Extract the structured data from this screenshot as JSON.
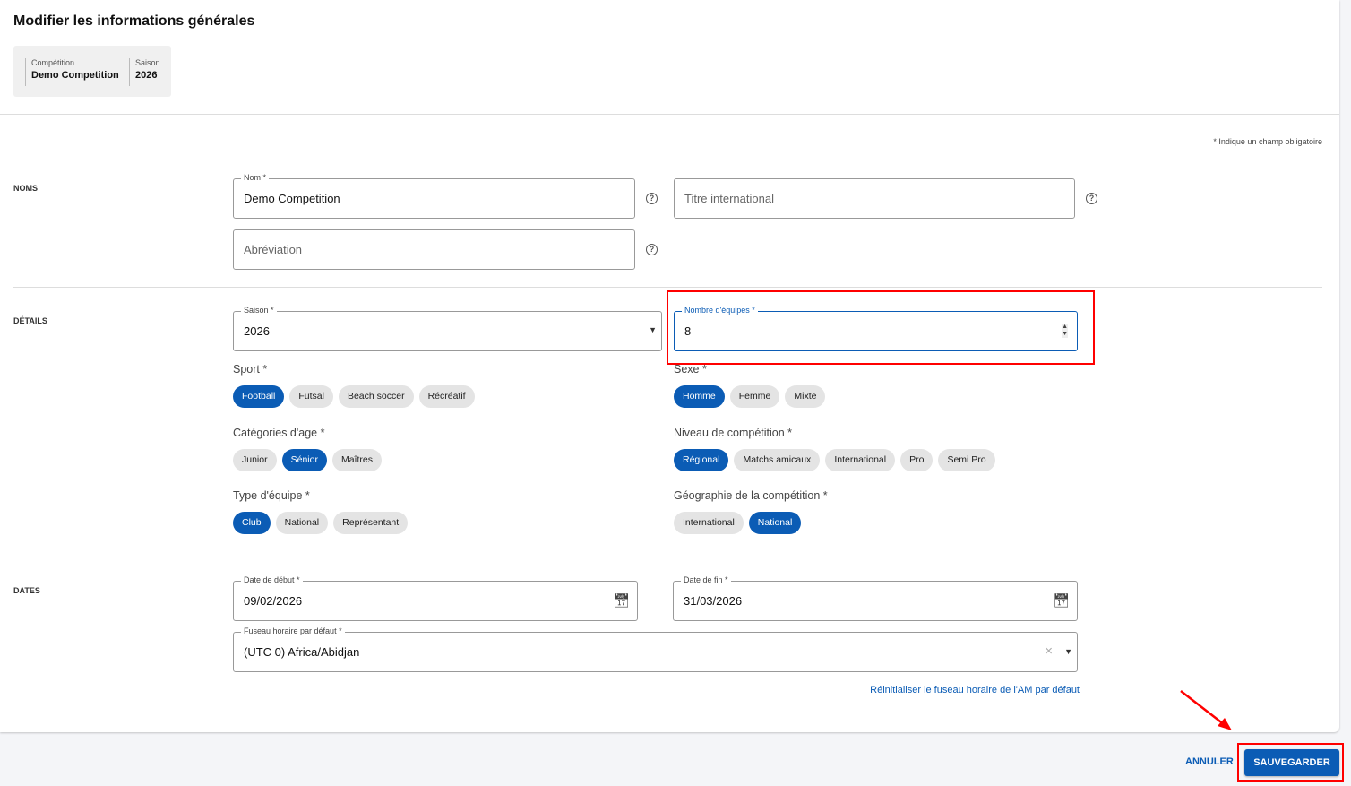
{
  "title": "Modifier les informations générales",
  "info": {
    "competition_label": "Compétition",
    "competition_value": "Demo Competition",
    "season_label": "Saison",
    "season_value": "2026"
  },
  "required_note": "* Indique un champ obligatoire",
  "sections": {
    "noms": "NOMS",
    "details": "DÉTAILS",
    "dates": "DATES"
  },
  "fields": {
    "nom": {
      "label": "Nom *",
      "value": "Demo Competition"
    },
    "titre": {
      "placeholder": "Titre international"
    },
    "abreviation": {
      "placeholder": "Abréviation"
    },
    "saison": {
      "label": "Saison *",
      "value": "2026"
    },
    "nombre": {
      "label": "Nombre d'équipes *",
      "value": "8"
    },
    "debut": {
      "label": "Date de début *",
      "value": "09/02/2026"
    },
    "fin": {
      "label": "Date de fin *",
      "value": "31/03/2026"
    },
    "fuseau": {
      "label": "Fuseau horaire par défaut *",
      "value": "(UTC 0) Africa/Abidjan"
    }
  },
  "groups": {
    "sport": {
      "label": "Sport *",
      "options": [
        "Football",
        "Futsal",
        "Beach soccer",
        "Récréatif"
      ],
      "selected": [
        "Football"
      ]
    },
    "sexe": {
      "label": "Sexe *",
      "options": [
        "Homme",
        "Femme",
        "Mixte"
      ],
      "selected": [
        "Homme"
      ]
    },
    "categories": {
      "label": "Catégories d'age *",
      "options": [
        "Junior",
        "Sénior",
        "Maîtres"
      ],
      "selected": [
        "Sénior"
      ]
    },
    "niveau": {
      "label": "Niveau de compétition *",
      "options": [
        "Régional",
        "Matchs amicaux",
        "International",
        "Pro",
        "Semi Pro"
      ],
      "selected": [
        "Régional"
      ]
    },
    "type": {
      "label": "Type d'équipe *",
      "options": [
        "Club",
        "National",
        "Représentant"
      ],
      "selected": [
        "Club"
      ]
    },
    "geo": {
      "label": "Géographie de la compétition *",
      "options": [
        "International",
        "National"
      ],
      "selected": [
        "National"
      ]
    }
  },
  "reset_link": "Réinitialiser le fuseau horaire de l'AM par défaut",
  "buttons": {
    "cancel": "ANNULER",
    "save": "SAUVEGARDER"
  },
  "colors": {
    "primary": "#0b5cb5",
    "highlight": "#ff0000"
  }
}
